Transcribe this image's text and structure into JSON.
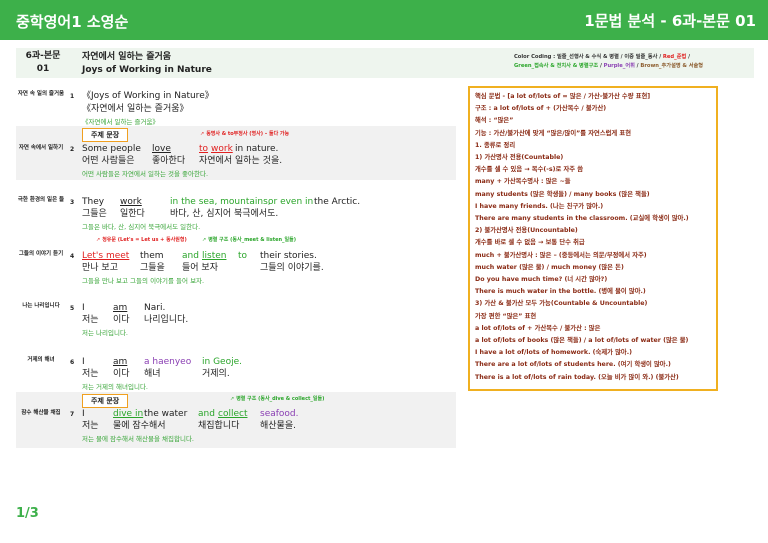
{
  "topbar": {
    "brand": "중학영어1 소영순",
    "section": "1문법 분석 - 6과-본문 01"
  },
  "header": {
    "code_line1": "6과-본문",
    "code_line2": "01",
    "title_ko": "자연에서 일하는 즐거움",
    "title_en": "Joys of Working in Nature",
    "coding_legend": {
      "prefix": "Color Coding : 밑줄_선행사 & 수식 & 병렬 / 이중 밑줄_동사 / ",
      "red": "Red_준법",
      "sep1": " /",
      "green": "Green_접속사 & 전치사 & 병렬구조",
      "sep2": " / ",
      "purple": "Purple_어휘",
      "sep3": " / ",
      "brown": "Brown_추가설명 & 서술형"
    }
  },
  "rows": [
    {
      "label": "자연 속 일의 즐거움",
      "num": "1",
      "en1": "《Joys of Working in Nature》",
      "en2": "《자연에서 일하는 즐거움》",
      "tr": "《자연에서 일하는 즐거움》"
    },
    {
      "label": "자연 속에서 일하기",
      "num": "2",
      "badge": "주제 문장",
      "note": "동명사 & to부정사 (명사) – 둘다 가능",
      "en": {
        "w1": "Some people",
        "w2": "love",
        "w3": "to",
        "w4": "work",
        "w5": "in nature."
      },
      "ko": {
        "k1": "어떤 사람들은",
        "k2": "좋아한다",
        "k3": "자연에서 일하는 것을."
      },
      "tr": "어떤 사람들은 자연에서 일하는 것을 좋아한다."
    },
    {
      "label": "극한 환경의 일은 들",
      "num": "3",
      "en": {
        "w1": "They",
        "w2": "work",
        "w3": "in the sea, mountains,",
        "w4": "or even in",
        "w5": "the Arctic."
      },
      "ko": {
        "k1": "그들은",
        "k2": "일한다",
        "k3": "바다, 산, 심지어 북극에서도."
      },
      "tr": "그들은 바다, 산, 심지어 북극에서도 일한다."
    },
    {
      "label": "그들의 이야기 듣기",
      "num": "4",
      "note1": "청유문 (Let's = Let us + 동사원형)",
      "note2": "병렬 구조 (동사_meet & listen_일들)",
      "en": {
        "w1": "Let's meet",
        "w2": "them",
        "w3": "and",
        "w4": "listen",
        "w5": "to",
        "w6": "their stories."
      },
      "ko": {
        "k1": "만나 보고",
        "k2": "그들을",
        "k3": "들어 보자",
        "k4": "그들의 이야기를."
      },
      "tr": "그들을 만나 보고 그들의 이야기를 들어 보자."
    },
    {
      "label": "나는 나리입니다",
      "num": "5",
      "en": {
        "w1": "I",
        "w2": "am",
        "w3": "Nari."
      },
      "ko": {
        "k1": "저는",
        "k2": "이다",
        "k3": "나리입니다."
      },
      "tr": "저는 나리입니다."
    },
    {
      "label": "거제의 해녀",
      "num": "6",
      "en": {
        "w1": "I",
        "w2": "am",
        "w3": "a haenyeo",
        "w4": "in Geoje."
      },
      "ko": {
        "k1": "저는",
        "k2": "이다",
        "k3": "해녀",
        "k4": "거제의."
      },
      "tr": "저는 거제의 해녀입니다."
    },
    {
      "label": "잠수 해산물 채집",
      "num": "7",
      "badge": "주제 문장",
      "note": "병렬 구조 (동사_dive & collect_일들)",
      "en": {
        "w1": "I",
        "w2": "dive in",
        "w3": "the water",
        "w4": "and",
        "w5": "collect",
        "w6": "seafood."
      },
      "ko": {
        "k1": "저는",
        "k2": "물에 잠수해서",
        "k3": "채집합니다",
        "k4": "해산물을."
      },
      "tr": "저는 물에 잠수해서 해산물을 채집합니다."
    }
  ],
  "grammar_box": [
    "핵심 문법 - [a lot of/lots of = 많은 / 가산-불가산 수량 표현]",
    "구조 : a lot of/lots of + (가산복수 / 불가산)",
    "해석 : “많은”",
    "기능 : 가산/불가산에 맞게 “많은/많이”를 자연스럽게 표현",
    "1. 종류로 정리",
    "1) 가산명사 전용(Countable)",
    "개수를 셀 수 있음 → 복수(-s)로 자주 씀",
    "many + 가산복수명사 : 많은 ~들",
    "many students (많은 학생들) / many books (많은 책들)",
    "I have many friends. (나는 친구가 많아.)",
    "There are many students in the classroom. (교실에 학생이 많아.)",
    "2) 불가산명사 전용(Uncountable)",
    "개수를 바로 셀 수 없음 → 보통 단수 취급",
    "much + 불가산명사 : 많은 – (중등에서는 의문/부정에서 자주)",
    "much water (많은 물) / much money (많은 돈)",
    "Do you have much time? (너 시간 많아?)",
    "There is much water in the bottle. (병에 물이 많아.)",
    "3) 가산 & 불가산 모두 가능(Countable & Uncountable)",
    "가장 편한 “많은” 표현",
    "a lot of/lots of + 가산복수 / 불가산 : 많은",
    "a lot of/lots of books (많은 책들) / a lot of/lots of water (많은 물)",
    "I have a lot of/lots of homework. (숙제가 많아.)",
    "There are a lot of/lots of students here. (여기 학생이 많아.)",
    "There is a lot of/lots of rain today. (오늘 비가 많이 와.) (불가산)"
  ],
  "page_indicator": "1/3"
}
